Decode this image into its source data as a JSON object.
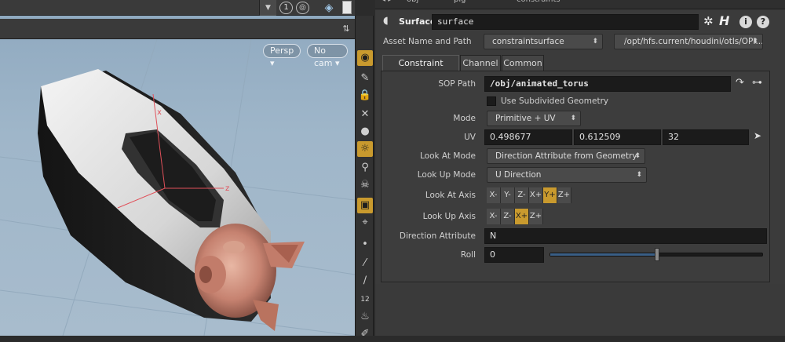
{
  "viewport": {
    "top_counter": "1",
    "camera_persp": "Persp",
    "camera_nocam": "No cam",
    "axis_x": "x",
    "axis_z": "z"
  },
  "toolbar": {
    "buttons": [
      "eye-icon",
      "brush-icon",
      "lock-icon",
      "cross-icon",
      "sphere-icon",
      "bulb-icon",
      "pin-icon",
      "skull-icon",
      "display-icon",
      "select-icon",
      "dot-icon",
      "pen-icon",
      "pipette-icon",
      "number-icon",
      "broom-icon",
      "dropper-icon"
    ],
    "number_label": "12"
  },
  "header": {
    "path_obj": "obj",
    "path_pig": "pig",
    "path_constraints": "constraints"
  },
  "node": {
    "type_label": "Surface",
    "name_value": "surface",
    "gear_icon": "gear-icon",
    "h_icon": "H"
  },
  "asset": {
    "label": "Asset Name and Path",
    "name": "constraintsurface",
    "path": "/opt/hfs.current/houdini/otls/OPI..."
  },
  "tabs": [
    "Constraint Surface",
    "Channel",
    "Common"
  ],
  "params": {
    "sop_path_label": "SOP Path",
    "sop_path_value": "/obj/animated_torus",
    "use_subdivided_label": "Use Subdivided Geometry",
    "mode_label": "Mode",
    "mode_value": "Primitive + UV",
    "uv_label": "UV",
    "uv_u": "0.498677",
    "uv_v": "0.612509",
    "uv_prim": "32",
    "look_at_mode_label": "Look At Mode",
    "look_at_mode_value": "Direction Attribute from Geometry",
    "look_up_mode_label": "Look Up Mode",
    "look_up_mode_value": "U Direction",
    "look_at_axis_label": "Look At Axis",
    "look_at_axis_options": [
      "X-",
      "Y-",
      "Z-",
      "X+",
      "Y+",
      "Z+"
    ],
    "look_at_axis_selected": "Y+",
    "look_up_axis_label": "Look Up Axis",
    "look_up_axis_options": [
      "X-",
      "Z-",
      "X+",
      "Z+"
    ],
    "look_up_axis_selected": "X+",
    "direction_attr_label": "Direction Attribute",
    "direction_attr_value": "N",
    "roll_label": "Roll",
    "roll_value": "0",
    "roll_slider_fraction": 0.505
  },
  "colors": {
    "accent": "#c99a2e",
    "panel_bg": "#3b3b3b",
    "field_bg": "#1b1b1b"
  }
}
